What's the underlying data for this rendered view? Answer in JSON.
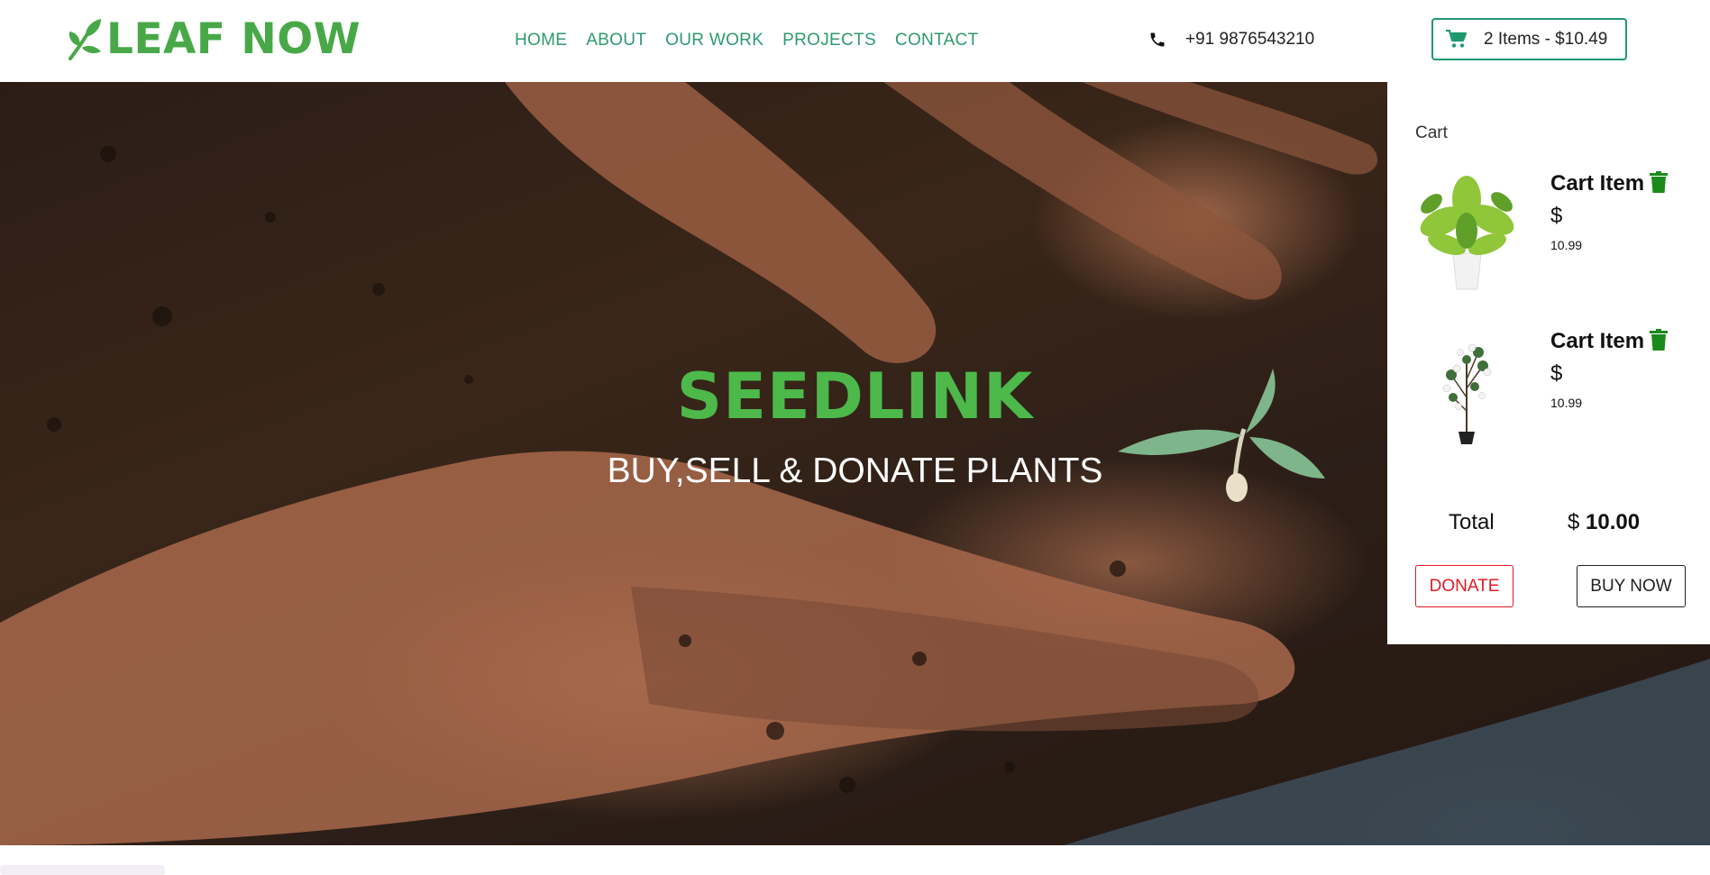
{
  "brand": {
    "name": "LEAF NOW",
    "icon": "leaf-icon",
    "color": "#48a848"
  },
  "nav": {
    "links": [
      {
        "label": "HOME"
      },
      {
        "label": "ABOUT"
      },
      {
        "label": "OUR WORK"
      },
      {
        "label": "PROJECTS"
      },
      {
        "label": "CONTACT"
      }
    ],
    "color": "#2e9a6e"
  },
  "contact": {
    "phone": "+91 9876543210",
    "icon": "phone-icon"
  },
  "cart_button": {
    "label": "2 Items - $10.49",
    "icon": "cart-icon",
    "border_color": "#1d9a6c"
  },
  "hero": {
    "title": "SEEDLINK",
    "subtitle": "BUY,SELL & DONATE PLANTS",
    "title_color": "#4cb94a"
  },
  "cart": {
    "heading": "Cart",
    "items": [
      {
        "name": "Cart Item",
        "currency": "$",
        "price": "10.99",
        "image": "potted-plant-leafy"
      },
      {
        "name": "Cart Item",
        "currency": "$",
        "price": "10.99",
        "image": "potted-plant-flowering"
      }
    ],
    "total_label": "Total",
    "total_currency": "$",
    "total_value": "10.00",
    "donate_label": "DONATE",
    "buy_label": "BUY NOW",
    "donate_color": "#e01b24",
    "trash_color": "#1b8a1b"
  }
}
